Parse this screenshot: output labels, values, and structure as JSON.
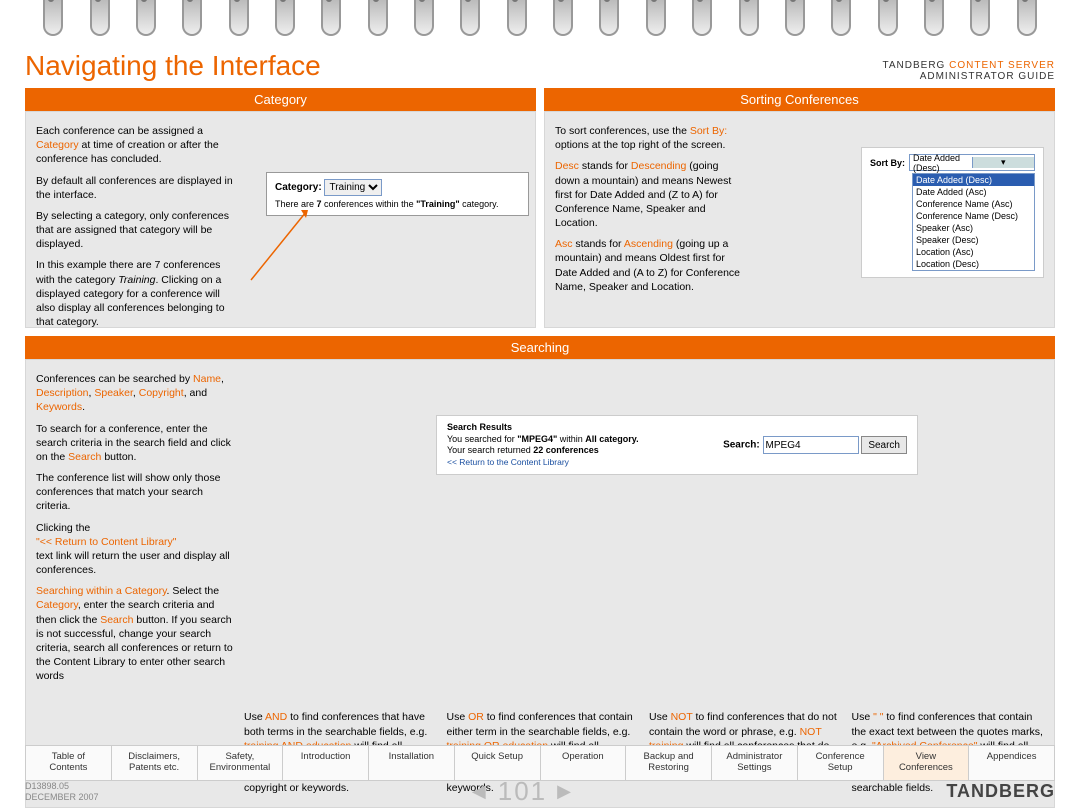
{
  "header": {
    "title": "Navigating the Interface",
    "prod1": "TANDBERG",
    "prod2": "CONTENT SERVER",
    "sub": "ADMINISTRATOR GUIDE"
  },
  "bars": {
    "category": "Category",
    "sorting": "Sorting Conferences",
    "searching": "Searching"
  },
  "category": {
    "p1a": "Each conference can be assigned a ",
    "p1b": "Category",
    "p1c": " at time of creation or after the conference has concluded.",
    "p2": "By default all conferences are displayed in the interface.",
    "p3": "By selecting a category, only conferences that are assigned that category will be displayed.",
    "p4a": "In this example there are 7 conferences with the category ",
    "p4b": "Training",
    "p4c": ". Clicking on a displayed category for a conference will also display all conferences belonging to that category.",
    "box_label": "Category:",
    "box_sel": "Training",
    "box_sub_a": "There are ",
    "box_sub_b": "7",
    "box_sub_c": " conferences within the ",
    "box_sub_d": "\"Training\"",
    "box_sub_e": " category."
  },
  "sorting": {
    "p1a": "To sort conferences, use the ",
    "p1b": "Sort By:",
    "p1c": " options at the top right of the screen.",
    "p2a": "Desc",
    "p2b": " stands for ",
    "p2c": "Descending",
    "p2d": " (going down a mountain) and means Newest first for Date Added and (Z to A) for Conference Name, Speaker and Location.",
    "p3a": "Asc",
    "p3b": " stands for ",
    "p3c": "Ascending",
    "p3d": " (going up a mountain) and means Oldest first for Date Added and (A to Z) for Conference Name, Speaker and Location.",
    "sort_label": "Sort By:",
    "opts": [
      "Date Added (Desc)",
      "Date Added (Asc)",
      "Conference Name (Asc)",
      "Conference Name (Desc)",
      "Speaker (Asc)",
      "Speaker (Desc)",
      "Location (Asc)",
      "Location (Desc)"
    ]
  },
  "search": {
    "p1a": "Conferences can be searched by ",
    "p1b": "Name",
    "p1c": "Description",
    "p1d": "Speaker",
    "p1e": "Copyright",
    "p1f": "Keywords",
    "p2a": "To search for a conference, enter the search criteria in the search field and click on the ",
    "p2b": "Search",
    "p2c": " button.",
    "p3": "The conference list will show only those conferences that match your search criteria.",
    "p4a": "Clicking the",
    "p4b": "\"<< Return to Content Library\"",
    "p4c": " text link will return the user and display all conferences.",
    "p5a": "Searching within a Category",
    "p5b": ". Select the ",
    "p5c": "Category",
    "p5d": ", enter the search criteria and then click the ",
    "p5e": "Search",
    "p5f": " button. If you search is not successful, change your search criteria, search all conferences or return to the Content Library to enter other search words",
    "res_title": "Search Results",
    "res_l1a": "You searched for ",
    "res_l1b": "\"MPEG4\"",
    "res_l1c": " within ",
    "res_l1d": "All category.",
    "res_l2a": "Your search returned ",
    "res_l2b": "22 conferences",
    "res_ret": "<< Return to the Content Library",
    "res_lbl": "Search:",
    "res_val": "MPEG4",
    "res_btn": "Search"
  },
  "tips": {
    "t1a": "Use ",
    "t1b": "AND",
    "t1c": " to find conferences that have both terms in the searchable fields, e.g. ",
    "t1d": "training AND education",
    "t1e": " will find all conferences with both training and education in name, description, speaker copyright or keywords.",
    "t2a": "Use ",
    "t2b": "OR",
    "t2c": " to find conferences that contain either term in the searchable fields, e.g. ",
    "t2d": "training OR education",
    "t2e": " will find all conferences with either training OR education in the title, description or as keywords.",
    "t3a": "Use ",
    "t3b": "NOT",
    "t3c": " to find conferences that do not contain the word or phrase, e.g. ",
    "t3d": "NOT training",
    "t3e": " will find all conferences that do not contain the word training.",
    "t4a": "Use ",
    "t4b": "\" \"",
    "t4c": " to find conferences that contain the exact text between the quotes marks, e.g. ",
    "t4d": "\"Archived Conference\"",
    "t4e": " will find all conferences that have the exact phrase between the quotes contained in the searchable fields."
  },
  "tabs": [
    "Table of Contents",
    "Disclaimers, Patents etc.",
    "Safety, Environmental",
    "Introduction",
    "Installation",
    "Quick Setup",
    "Operation",
    "Backup and Restoring",
    "Administrator Settings",
    "Conference Setup",
    "View Conferences",
    "Appendices"
  ],
  "footer": {
    "doc": "D13898.05",
    "date": "DECEMBER 2007",
    "page": "101",
    "brand": "TANDBERG"
  }
}
